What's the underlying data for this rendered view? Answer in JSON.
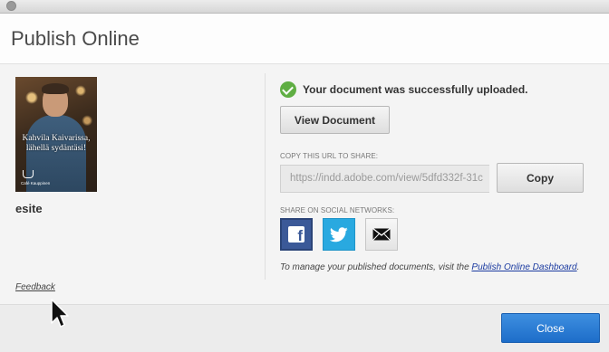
{
  "window": {
    "title": "Publish Online"
  },
  "document": {
    "name": "esite",
    "thumbnail_text": "Kahvila Kaivarissa, lähellä sydäntäsi!",
    "thumbnail_small_text": "Café Kauppinen"
  },
  "links": {
    "feedback": "Feedback"
  },
  "status": {
    "message": "Your document was successfully uploaded."
  },
  "buttons": {
    "view_document": "View Document",
    "copy": "Copy",
    "close": "Close"
  },
  "share": {
    "url_label": "COPY THIS URL TO SHARE:",
    "url_value": "https://indd.adobe.com/view/5dfd332f-31c",
    "social_label": "SHARE ON SOCIAL NETWORKS:",
    "networks": [
      {
        "name": "Facebook",
        "icon": "facebook-icon",
        "color": "#3b5998"
      },
      {
        "name": "Twitter",
        "icon": "twitter-icon",
        "color": "#29a9e0"
      },
      {
        "name": "Email",
        "icon": "email-icon",
        "color": "#000000"
      }
    ]
  },
  "manage": {
    "text": "To manage your published documents, visit the ",
    "link": "Publish Online Dashboard",
    "suffix": "."
  },
  "colors": {
    "accent": "#1d6dc9",
    "success": "#5fae43",
    "link": "#1a3aa0"
  }
}
